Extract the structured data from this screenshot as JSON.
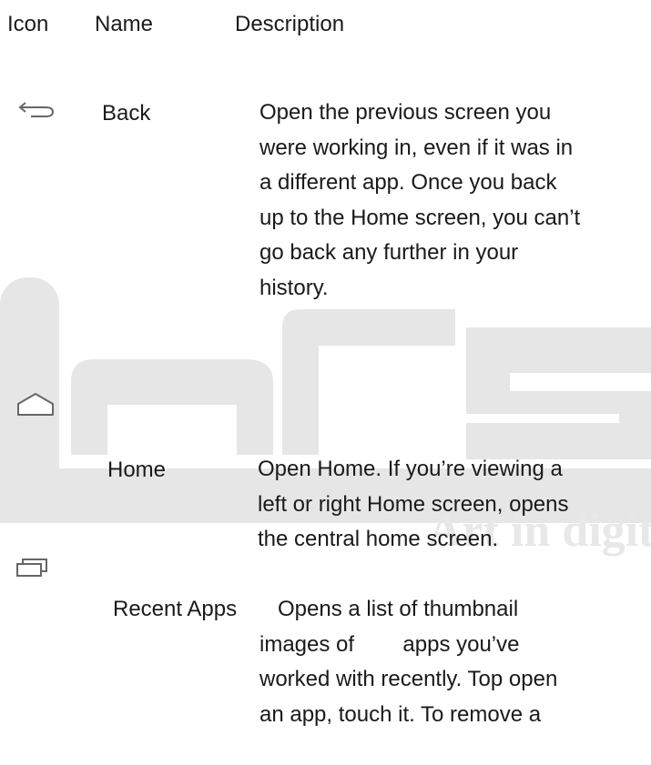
{
  "header": {
    "icon": "Icon",
    "name": "Name",
    "description": "Description"
  },
  "rows": [
    {
      "icon": "back-arrow-icon",
      "name": "Back",
      "description": [
        "Open the previous screen you",
        "were working in, even if it was in",
        "a different app. Once you back",
        "up to the Home screen, you can’t",
        "go back any further in your",
        "history."
      ]
    },
    {
      "icon": "home-icon",
      "name": "Home",
      "description": [
        "Open Home. If you’re viewing a",
        "left or right Home screen, opens",
        "the central home screen."
      ]
    },
    {
      "icon": "recent-apps-icon",
      "name": "Recent Apps",
      "description": [
        "   Opens a list of thumbnail",
        "images of        apps you’ve",
        "worked with recently. Top open",
        "an app, touch it. To remove a"
      ]
    }
  ],
  "watermark": {
    "text": "Art in digit",
    "color": "#e6e6e6"
  }
}
